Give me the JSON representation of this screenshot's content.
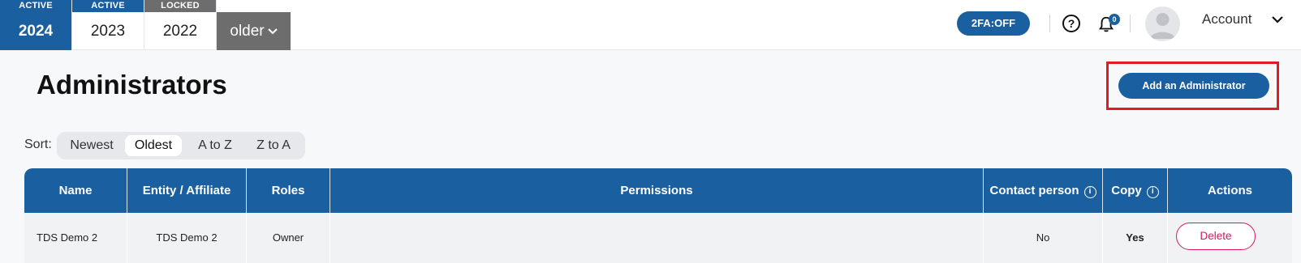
{
  "years": [
    {
      "status": "ACTIVE",
      "year": "2024"
    },
    {
      "status": "ACTIVE",
      "year": "2023"
    },
    {
      "status": "LOCKED",
      "year": "2022"
    }
  ],
  "older_label": "older",
  "header": {
    "twofa_label": "2FA:OFF",
    "help_glyph": "?",
    "notification_count": "0",
    "account_label": "Account"
  },
  "page": {
    "title": "Administrators",
    "add_button_label": "Add an Administrator"
  },
  "sort": {
    "label": "Sort:",
    "options": [
      "Newest",
      "Oldest",
      "A to Z",
      "Z to A"
    ],
    "selected": "Oldest"
  },
  "table": {
    "columns": [
      "Name",
      "Entity / Affiliate",
      "Roles",
      "Permissions",
      "Contact person",
      "Copy",
      "Actions"
    ],
    "rows": [
      {
        "name": "TDS Demo 2",
        "entity": "TDS Demo 2",
        "role": "Owner",
        "permissions": "",
        "contact_person": "No",
        "copy": "Yes",
        "action_label": "Delete"
      }
    ]
  },
  "colors": {
    "primary": "#1a5fa0",
    "locked": "#6d6d6d",
    "highlight": "#e01b24",
    "danger": "#e0145e"
  },
  "icons": {
    "help": "question-circle-icon",
    "notifications": "bell-icon",
    "avatar": "user-avatar-icon",
    "account_menu": "chevron-down-icon",
    "info": "info-icon"
  }
}
